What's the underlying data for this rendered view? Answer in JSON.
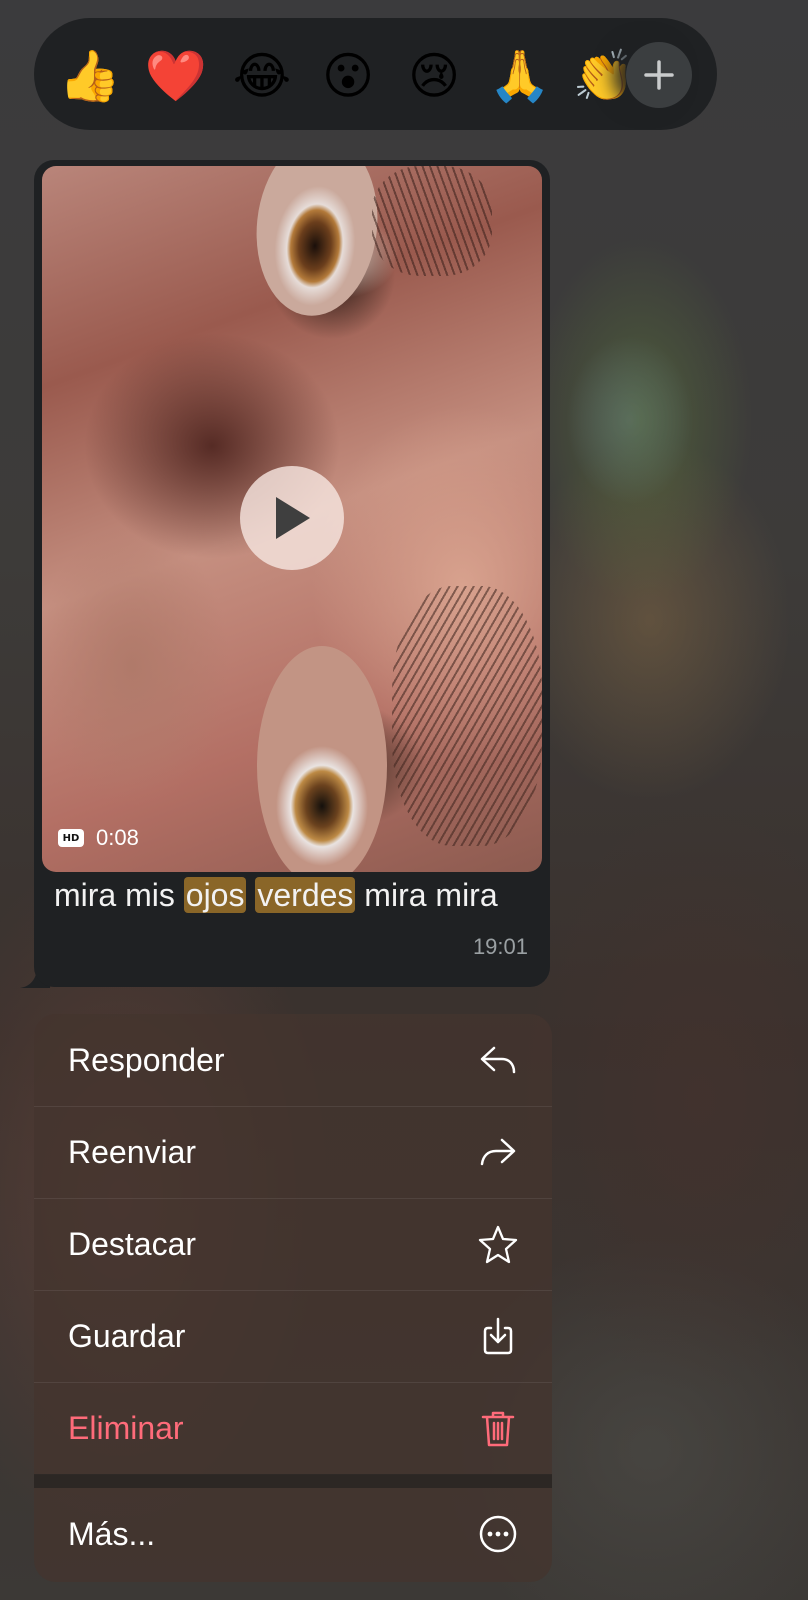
{
  "reactions": {
    "emojis": [
      {
        "glyph": "👍",
        "name": "thumbs-up"
      },
      {
        "glyph": "❤️",
        "name": "heart"
      },
      {
        "glyph": "😂",
        "name": "tears-of-joy"
      },
      {
        "glyph": "😮",
        "name": "surprised"
      },
      {
        "glyph": "😢",
        "name": "crying"
      },
      {
        "glyph": "🙏",
        "name": "folded-hands"
      },
      {
        "glyph": "👏",
        "name": "clapping"
      }
    ],
    "more_icon": "plus-icon"
  },
  "message": {
    "video": {
      "hd_label": "HD",
      "duration": "0:08"
    },
    "caption": {
      "part1": "mira mis ",
      "highlight1": "ojos",
      "highlight2": "verdes",
      "part2": " mira mira"
    },
    "time": "19:01",
    "highlight_color": "#8a6628"
  },
  "menu": {
    "items": [
      {
        "label": "Responder",
        "icon": "reply-icon"
      },
      {
        "label": "Reenviar",
        "icon": "forward-icon"
      },
      {
        "label": "Destacar",
        "icon": "star-icon"
      },
      {
        "label": "Guardar",
        "icon": "save-icon"
      },
      {
        "label": "Eliminar",
        "icon": "trash-icon",
        "color": "#ff6b7a"
      },
      {
        "label": "Más...",
        "icon": "more-icon"
      }
    ]
  }
}
